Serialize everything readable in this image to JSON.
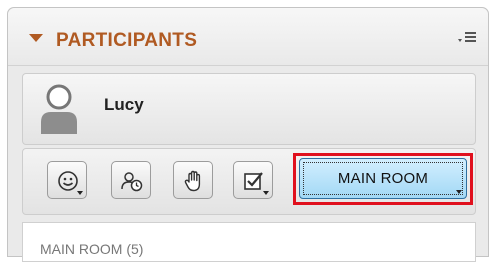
{
  "panel": {
    "title": "PARTICIPANTS"
  },
  "user": {
    "name": "Lucy"
  },
  "toolbar": {
    "buttons": [
      {
        "name": "status-emoji-icon"
      },
      {
        "name": "away-clock-icon"
      },
      {
        "name": "raise-hand-icon"
      },
      {
        "name": "checkbox-poll-icon"
      }
    ],
    "room_button_label": "MAIN ROOM"
  },
  "list": {
    "header": "MAIN ROOM (5)"
  },
  "colors": {
    "title": "#b05a22",
    "highlight": "#e0101d",
    "room_button": "#a2d8f5"
  }
}
